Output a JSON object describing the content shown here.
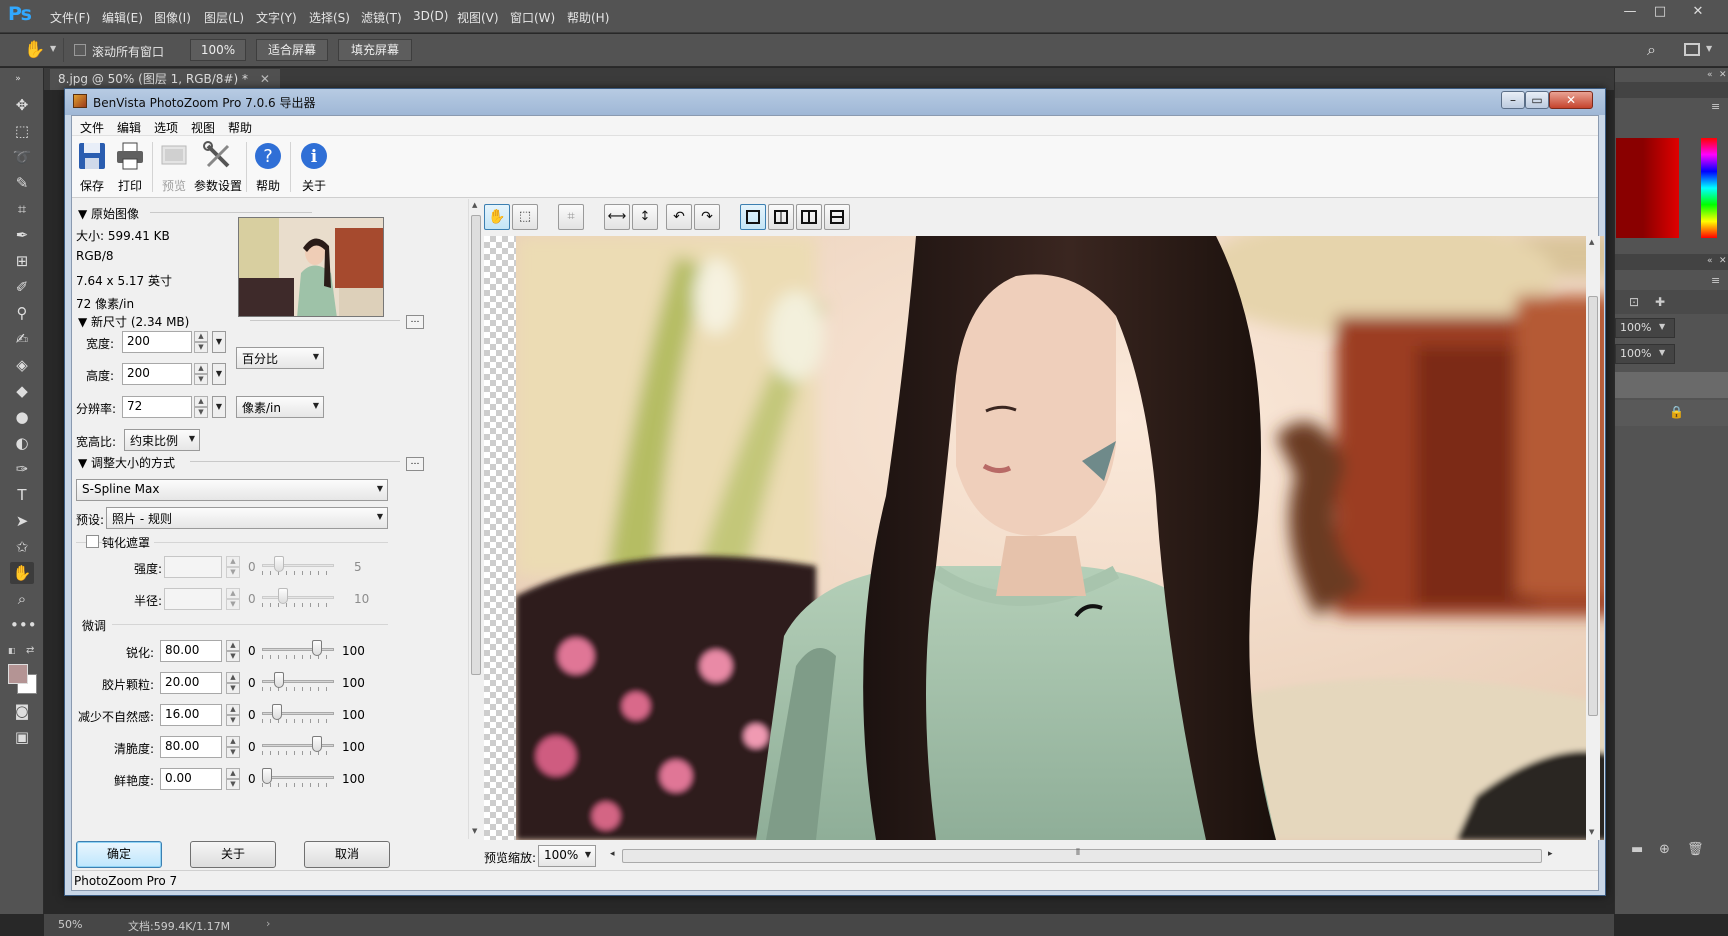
{
  "ps": {
    "logo": "Ps",
    "menus": [
      "文件(F)",
      "编辑(E)",
      "图像(I)",
      "图层(L)",
      "文字(Y)",
      "选择(S)",
      "滤镜(T)",
      "3D(D)",
      "视图(V)",
      "窗口(W)",
      "帮助(H)"
    ],
    "options": {
      "scroll_all_label": "滚动所有窗口",
      "zoom_value": "100%",
      "fit_screen": "适合屏幕",
      "fill_screen": "填充屏幕"
    },
    "doc_tab": "8.jpg @ 50% (图层 1, RGB/8#) *",
    "status": {
      "zoom": "50%",
      "doc": "文档:599.4K/1.17M"
    },
    "right_panel": {
      "zoom_a": "100%",
      "zoom_b": "100%"
    }
  },
  "pz": {
    "title": "BenVista PhotoZoom Pro 7.0.6 导出器",
    "menus": [
      "文件",
      "编辑",
      "选项",
      "视图",
      "帮助"
    ],
    "tools": {
      "save": "保存",
      "print": "打印",
      "preview": "预览",
      "settings": "参数设置",
      "help": "帮助",
      "about": "关于"
    },
    "original": {
      "header": "原始图像",
      "size": "大小: 599.41 KB",
      "mode": "RGB/8",
      "dims": "7.64 x 5.17 英寸",
      "res": "72 像素/in"
    },
    "newsize": {
      "header": "新尺寸 (2.34 MB)",
      "width_label": "宽度:",
      "width": "200",
      "height_label": "高度:",
      "height": "200",
      "res_label": "分辨率:",
      "res": "72",
      "unit": "百分比",
      "res_unit": "像素/in",
      "aspect_label": "宽高比:",
      "aspect": "约束比例"
    },
    "resize": {
      "header": "调整大小的方式",
      "method": "S-Spline Max",
      "preset_label": "预设:",
      "preset": "照片 - 规则"
    },
    "unsharp": {
      "label": "钝化遮罩",
      "strength_label": "强度:",
      "strength_min": "0",
      "strength_max": "5",
      "radius_label": "半径:",
      "radius_min": "0",
      "radius_max": "10"
    },
    "fine": {
      "header": "微调",
      "rows": [
        {
          "label": "锐化:",
          "value": "80.00",
          "min": "0",
          "max": "100",
          "level": 0.8
        },
        {
          "label": "胶片颗粒:",
          "value": "20.00",
          "min": "0",
          "max": "100",
          "level": 0.2
        },
        {
          "label": "减少不自然感:",
          "value": "16.00",
          "min": "0",
          "max": "100",
          "level": 0.16
        },
        {
          "label": "清脆度:",
          "value": "80.00",
          "min": "0",
          "max": "100",
          "level": 0.8
        },
        {
          "label": "鲜艳度:",
          "value": "0.00",
          "min": "0",
          "max": "100",
          "level": 0.0
        }
      ]
    },
    "buttons": {
      "ok": "确定",
      "about": "关于",
      "cancel": "取消"
    },
    "preview_zoom_label": "预览缩放:",
    "preview_zoom": "100%",
    "status": "PhotoZoom Pro 7"
  }
}
